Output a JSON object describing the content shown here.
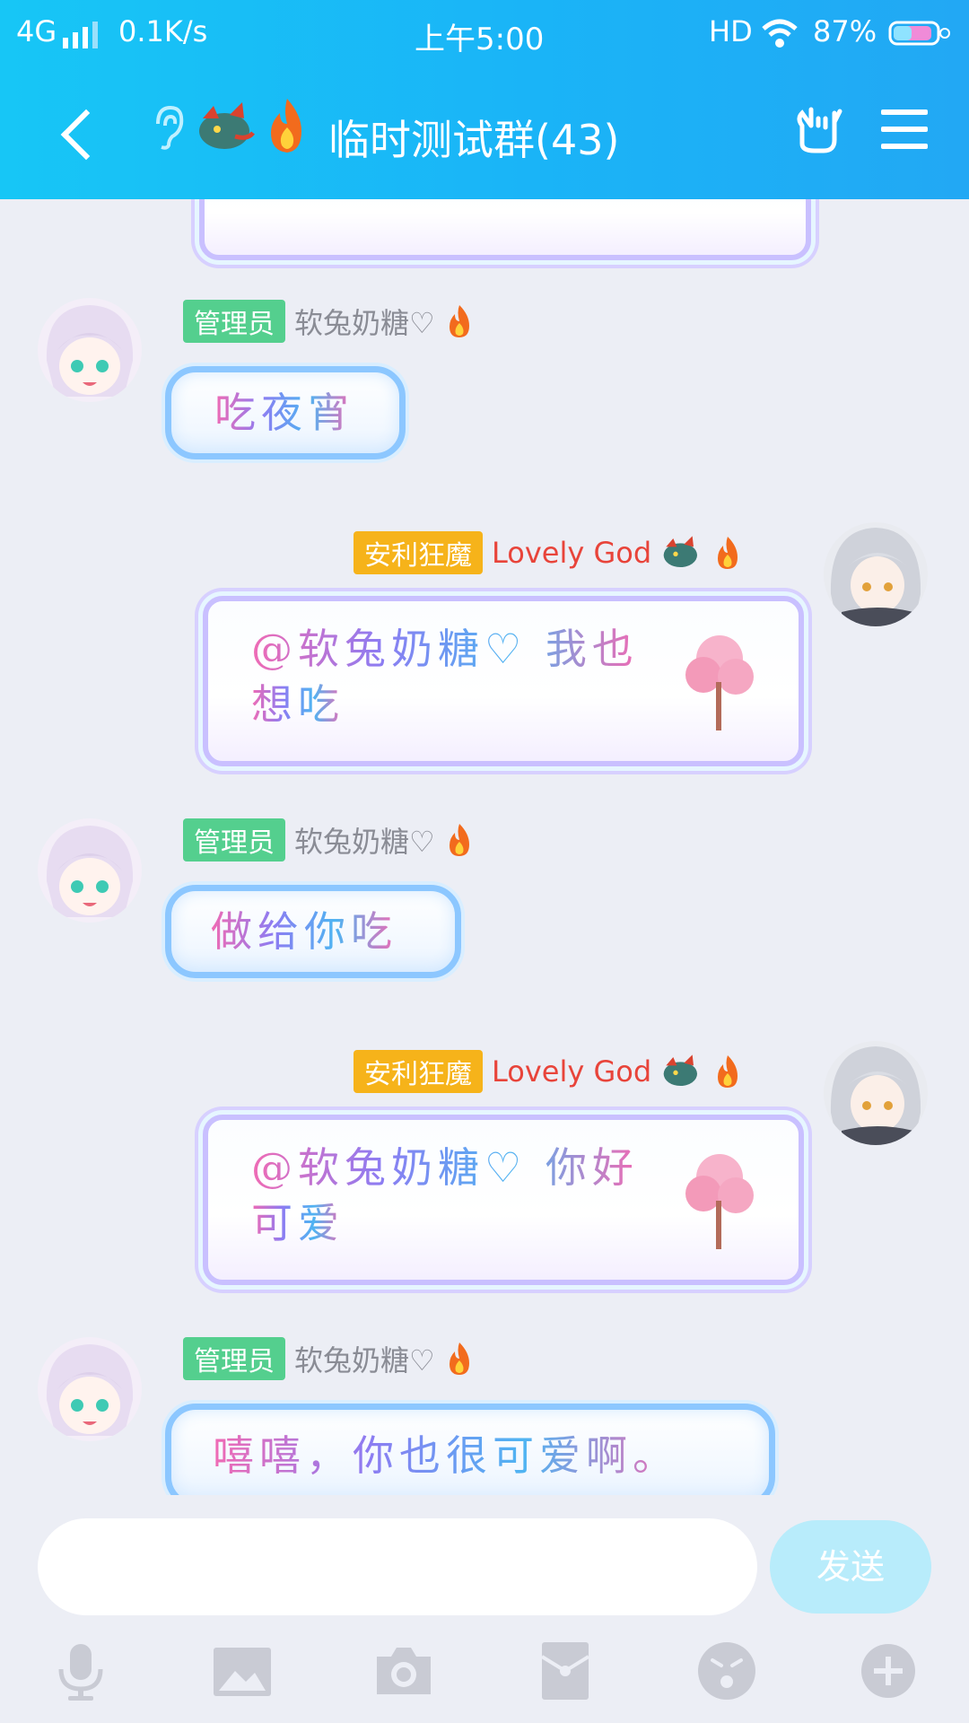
{
  "status_bar": {
    "network": "4G",
    "speed": "0.1K/s",
    "time": "上午5:00",
    "hd": "HD",
    "battery": "87%"
  },
  "header": {
    "title": "临时测试群(43)"
  },
  "messages": [
    {
      "side": "left",
      "role_tag": "管理员",
      "name": "软兔奶糖♡",
      "text": "吃夜宵"
    },
    {
      "side": "right",
      "role_tag": "安利狂魔",
      "name": "Lovely God",
      "text_line1": "@软兔奶糖♡ 我也",
      "text_line2": "想吃"
    },
    {
      "side": "left",
      "role_tag": "管理员",
      "name": "软兔奶糖♡",
      "text": "做给你吃"
    },
    {
      "side": "right",
      "role_tag": "安利狂魔",
      "name": "Lovely God",
      "text_line1": "@软兔奶糖♡ 你好",
      "text_line2": "可爱"
    },
    {
      "side": "left",
      "role_tag": "管理员",
      "name": "软兔奶糖♡",
      "text": "嘻嘻，你也很可爱啊。"
    }
  ],
  "composer": {
    "placeholder": "",
    "send_label": "发送"
  },
  "icons": {
    "back": "chevron-left-icon",
    "ear": "ear-icon",
    "menu": "menu-icon",
    "gesture": "hand-gesture-icon",
    "toolbar": [
      "microphone-icon",
      "image-icon",
      "camera-icon",
      "red-packet-icon",
      "emoji-icon",
      "plus-icon"
    ]
  },
  "colors": {
    "header": "#1ab4f7",
    "admin_tag": "#54cf8e",
    "fan_tag": "#f6b31a",
    "red_name": "#e8443a",
    "send_button": "#b8ecfb"
  }
}
